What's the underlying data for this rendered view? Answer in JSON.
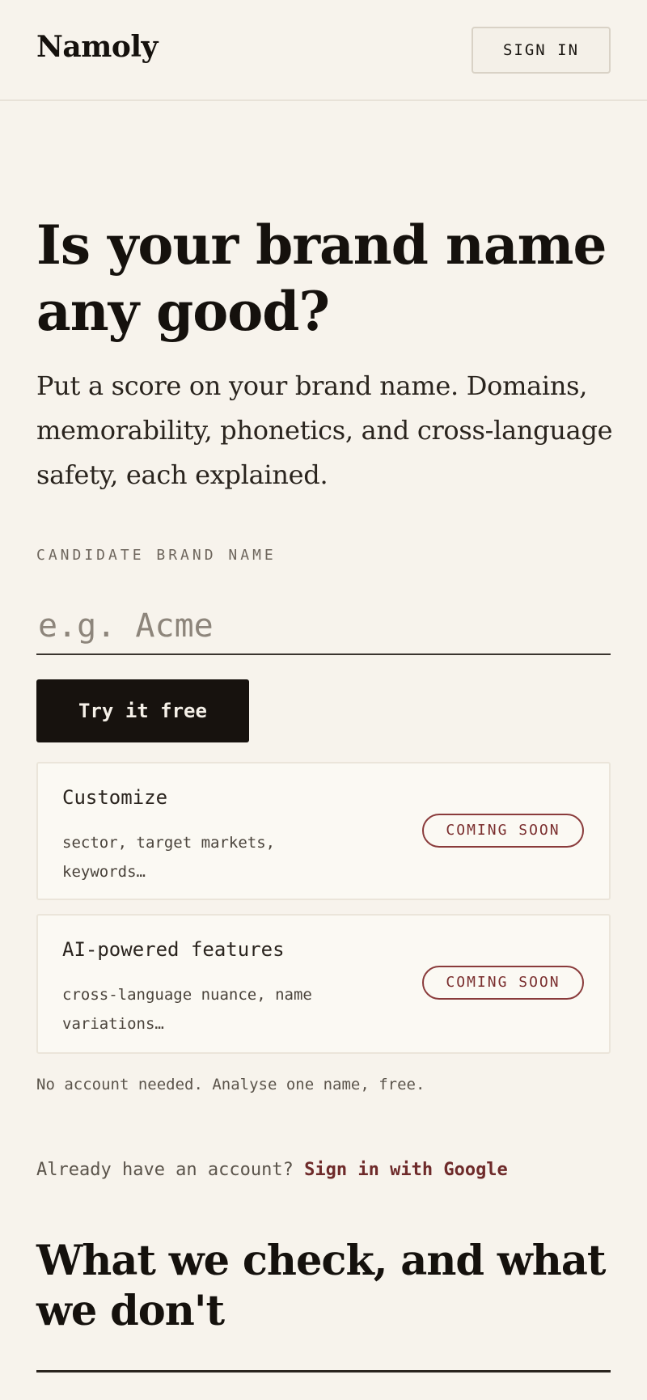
{
  "header": {
    "logo": "Namoly",
    "sign_in_label": "SIGN IN"
  },
  "hero": {
    "title": "Is your brand name any good?",
    "subtitle": "Put a score on your brand name. Domains, memorability, phonetics, and cross-language safety, each explained."
  },
  "form": {
    "label": "CANDIDATE BRAND NAME",
    "input_value": "",
    "input_placeholder": "e.g. Acme",
    "submit_label": "Try it free"
  },
  "features": [
    {
      "title": "Customize",
      "description": "sector, target markets, keywords…",
      "badge": "COMING SOON"
    },
    {
      "title": "AI-powered features",
      "description": "cross-language nuance, name variations…",
      "badge": "COMING SOON"
    }
  ],
  "note": "No account needed. Analyse one name, free.",
  "account": {
    "prompt": "Already have an account?",
    "link_label": "Sign in with Google"
  },
  "section": {
    "title": "What we check, and what we don't"
  },
  "colors": {
    "background": "#f7f3ec",
    "button_dark": "#17120e",
    "badge_accent": "#7a2e2e"
  }
}
